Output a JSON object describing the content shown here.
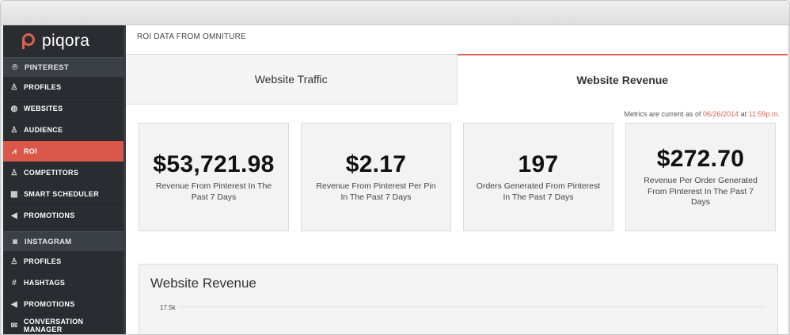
{
  "app": {
    "logo_text": "piqora"
  },
  "sidebar": {
    "sections": [
      {
        "header": "PINTEREST",
        "items": [
          {
            "label": "PROFILES",
            "icon": "profile-icon"
          },
          {
            "label": "WEBSITES",
            "icon": "globe-icon"
          },
          {
            "label": "AUDIENCE",
            "icon": "audience-icon"
          },
          {
            "label": "ROI",
            "icon": "chart-icon",
            "active": true
          },
          {
            "label": "COMPETITORS",
            "icon": "competitors-icon"
          },
          {
            "label": "SMART SCHEDULER",
            "icon": "calendar-icon"
          },
          {
            "label": "PROMOTIONS",
            "icon": "megaphone-icon"
          }
        ]
      },
      {
        "header": "INSTAGRAM",
        "items": [
          {
            "label": "PROFILES",
            "icon": "profile-icon"
          },
          {
            "label": "HASHTAGS",
            "icon": "hashtag-icon"
          },
          {
            "label": "PROMOTIONS",
            "icon": "megaphone-icon"
          },
          {
            "label": "CONVERSATION MANAGER",
            "icon": "chat-icon"
          }
        ]
      }
    ]
  },
  "main": {
    "breadcrumb": "ROI DATA FROM OMNITURE",
    "tabs": [
      {
        "label": "Website Traffic",
        "active": false
      },
      {
        "label": "Website Revenue",
        "active": true
      }
    ],
    "metrics": {
      "prefix": "Metrics are current as of",
      "date": "06/26/2014",
      "at": "at",
      "time": "11:59p.m."
    },
    "cards": [
      {
        "value": "$53,721.98",
        "label": "Revenue From Pinterest In The Past 7 Days"
      },
      {
        "value": "$2.17",
        "label": "Revenue From Pinterest Per Pin In The Past 7 Days"
      },
      {
        "value": "197",
        "label": "Orders Generated From Pinterest In The Past 7 Days"
      },
      {
        "value": "$272.70",
        "label": "Revenue Per Order Generated From Pinterest In The Past 7 Days"
      }
    ],
    "chart": {
      "title": "Website Revenue",
      "tick": "17.5k"
    }
  },
  "colors": {
    "accent": "#e0604f",
    "sidebar_bg": "#2a2c31"
  }
}
